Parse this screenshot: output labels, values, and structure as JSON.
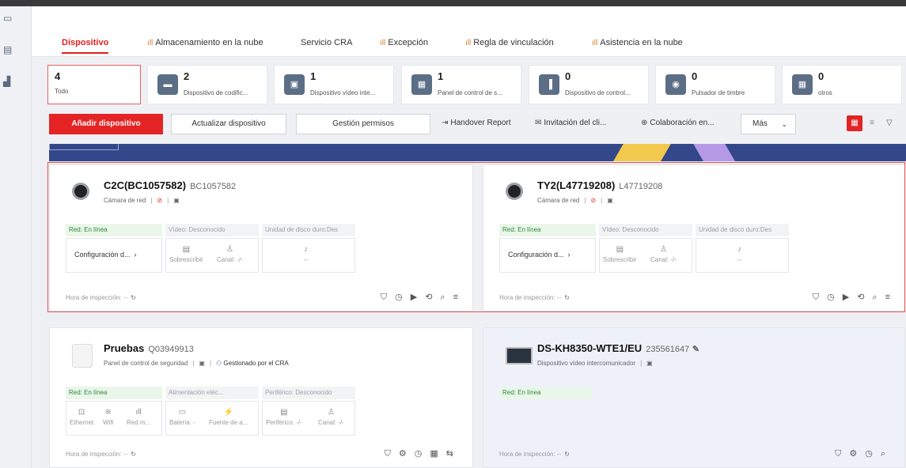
{
  "leftbar": {
    "icons": [
      "devices-icon",
      "storage-icon",
      "stats-icon"
    ]
  },
  "tabs": [
    {
      "label": "Dispositivo",
      "active": true
    },
    {
      "label": "Almacenamiento en la nube"
    },
    {
      "label": "Servicio CRA"
    },
    {
      "label": "Excepción"
    },
    {
      "label": "Regla de vinculación"
    },
    {
      "label": "Asistencia en la nube"
    }
  ],
  "categories": [
    {
      "count": "4",
      "label": "Todo",
      "icon": ""
    },
    {
      "count": "2",
      "label": "Dispositivo de codific...",
      "icon": "encoder-icon"
    },
    {
      "count": "1",
      "label": "Dispositivo vídeo inte...",
      "icon": "video-intercom-icon"
    },
    {
      "count": "1",
      "label": "Panel de control de s...",
      "icon": "security-panel-icon"
    },
    {
      "count": "0",
      "label": "Dispositivo de control...",
      "icon": "access-control-icon"
    },
    {
      "count": "0",
      "label": "Pulsador de timbre",
      "icon": "doorbell-icon"
    },
    {
      "count": "0",
      "label": "otros",
      "icon": "other-icon"
    }
  ],
  "toolbar": {
    "add": "Añadir dispositivo",
    "update": "Actualizar dispositivo",
    "permissions": "Gestión permisos",
    "handover": "Handover Report",
    "invite": "Invitación del cli...",
    "collab": "Colaboración en...",
    "more": "Más"
  },
  "cards": [
    {
      "name": "C2C(BC1057582)",
      "serial": "BC1057582",
      "type": "Cámara de red",
      "network": "Red: En línea",
      "video": "Vídeo: Desconocido",
      "disk": "Unidad de disco duro:Des",
      "config": "Configuración d...",
      "overwrite": "Sobrescribir",
      "channel": "Canal: -/-",
      "mic_dash": "--",
      "inspect": "Hora de inspección: --"
    },
    {
      "name": "TY2(L47719208)",
      "serial": "L47719208",
      "type": "Cámara de red",
      "network": "Red: En línea",
      "video": "Vídeo: Desconocido",
      "disk": "Unidad de disco duro:Des",
      "config": "Configuración d...",
      "overwrite": "Sobrescribir",
      "channel": "Canal: -/-",
      "mic_dash": "--",
      "inspect": "Hora de inspección: --"
    },
    {
      "name": "Pruebas",
      "serial": "Q03949913",
      "type": "Panel de control de seguridad",
      "managed": "Gestionado por el CRA",
      "network": "Red: En línea",
      "power": "Alimentación eléc...",
      "peripheral": "Periférico: Desconocido",
      "ethernet": "Ethernet",
      "wifi": "Wifi",
      "mobile": "Red m...",
      "battery": "Batería: -",
      "source": "Fuente de a...",
      "periph_val": "Periférico: -/-",
      "channel": "Canal: -/-",
      "inspect": "Hora de inspección: --"
    },
    {
      "name": "DS-KH8350-WTE1/EU",
      "serial": "235561647",
      "type": "Dispositivo vídeo intercomunicador",
      "network": "Red: En línea",
      "inspect": "Hora de inspección: --"
    }
  ],
  "colors": {
    "accent": "#e42424",
    "online": "#2f8a3a",
    "banner": "#33478a"
  }
}
